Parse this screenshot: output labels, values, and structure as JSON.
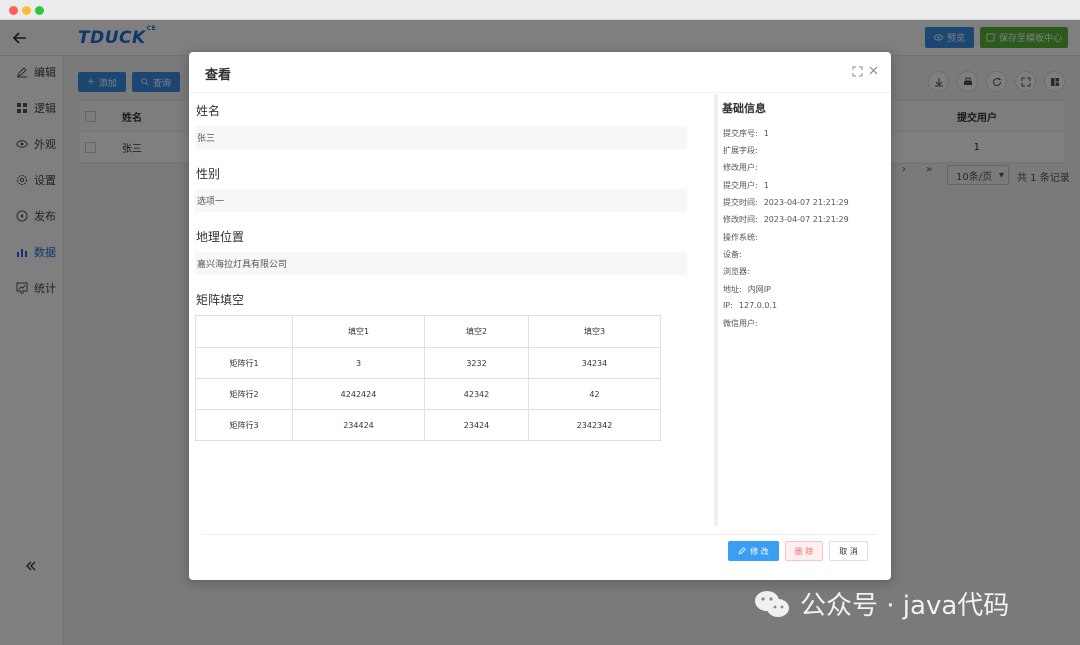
{
  "app": {
    "logo_text": "TDUCK",
    "logo_sup": "CE",
    "preview_label": "预览",
    "save_template_label": "保存至模板中心"
  },
  "sidebar": {
    "items": [
      {
        "label": "编辑",
        "icon": "pencil-icon"
      },
      {
        "label": "逻辑",
        "icon": "grid-icon"
      },
      {
        "label": "外观",
        "icon": "eye-icon"
      },
      {
        "label": "设置",
        "icon": "gear-icon"
      },
      {
        "label": "发布",
        "icon": "play-icon"
      },
      {
        "label": "数据",
        "icon": "bar-chart-icon"
      },
      {
        "label": "统计",
        "icon": "stats-icon"
      }
    ],
    "active": "数据"
  },
  "background": {
    "add_label": "添加",
    "query_label": "查询",
    "columns": [
      "姓名",
      "提交用户"
    ],
    "row": {
      "name": "张三",
      "submit_user": "1"
    },
    "page_size": "10条/页",
    "total": "共 1 条记录"
  },
  "modal": {
    "title": "查看",
    "fields": [
      {
        "label": "姓名",
        "value": "张三"
      },
      {
        "label": "性别",
        "value": "选项一"
      },
      {
        "label": "地理位置",
        "value": "嘉兴海拉灯具有限公司"
      }
    ],
    "matrix": {
      "label": "矩阵填空",
      "columns": [
        "",
        "填空1",
        "填空2",
        "填空3"
      ],
      "rows": [
        [
          "矩阵行1",
          "3",
          "3232",
          "34234"
        ],
        [
          "矩阵行2",
          "4242424",
          "42342",
          "42"
        ],
        [
          "矩阵行3",
          "234424",
          "23424",
          "2342342"
        ]
      ]
    },
    "info": {
      "title": "基础信息",
      "rows": [
        {
          "k": "提交序号:",
          "v": "1"
        },
        {
          "k": "扩展字段:",
          "v": ""
        },
        {
          "k": "修改用户:",
          "v": ""
        },
        {
          "k": "提交用户:",
          "v": "1"
        },
        {
          "k": "提交时间:",
          "v": "2023-04-07 21:21:29"
        },
        {
          "k": "修改时间:",
          "v": "2023-04-07 21:21:29"
        },
        {
          "k": "操作系统:",
          "v": ""
        },
        {
          "k": "设备:",
          "v": ""
        },
        {
          "k": "浏览器:",
          "v": ""
        },
        {
          "k": "地址:",
          "v": "内网IP"
        },
        {
          "k": "IP:",
          "v": "127.0.0.1"
        },
        {
          "k": "微信用户:",
          "v": ""
        }
      ]
    },
    "edit_label": "修 改",
    "delete_label": "删 除",
    "cancel_label": "取 消"
  },
  "watermark": {
    "text": "公众号 · java代码"
  }
}
